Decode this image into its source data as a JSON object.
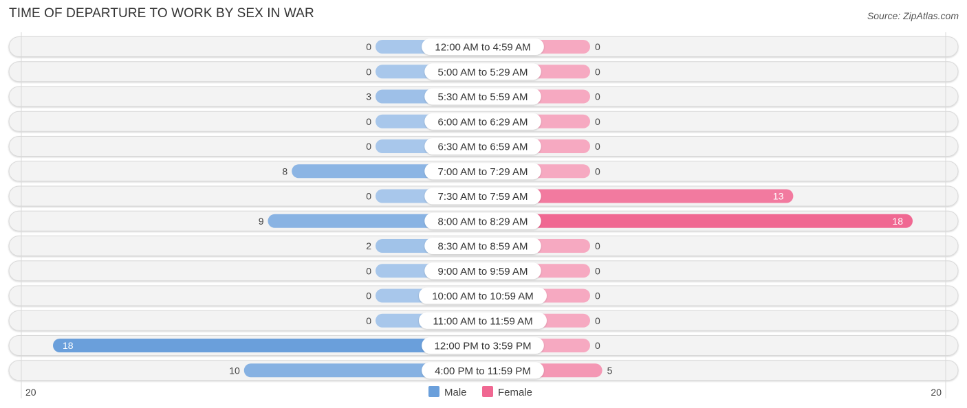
{
  "title": "TIME OF DEPARTURE TO WORK BY SEX IN WAR",
  "source": "Source: ZipAtlas.com",
  "chart_data": {
    "type": "bar",
    "orientation": "horizontal-diverging",
    "title": "TIME OF DEPARTURE TO WORK BY SEX IN WAR",
    "categories": [
      "12:00 AM to 4:59 AM",
      "5:00 AM to 5:29 AM",
      "5:30 AM to 5:59 AM",
      "6:00 AM to 6:29 AM",
      "6:30 AM to 6:59 AM",
      "7:00 AM to 7:29 AM",
      "7:30 AM to 7:59 AM",
      "8:00 AM to 8:29 AM",
      "8:30 AM to 8:59 AM",
      "9:00 AM to 9:59 AM",
      "10:00 AM to 10:59 AM",
      "11:00 AM to 11:59 AM",
      "12:00 PM to 3:59 PM",
      "4:00 PM to 11:59 PM"
    ],
    "series": [
      {
        "name": "Male",
        "color": "#6a9fdb",
        "light_color": "#a8c7eb",
        "values": [
          0,
          0,
          3,
          0,
          0,
          8,
          0,
          9,
          2,
          0,
          0,
          0,
          18,
          10
        ]
      },
      {
        "name": "Female",
        "color": "#f06892",
        "light_color": "#f6a9c1",
        "values": [
          0,
          0,
          0,
          0,
          0,
          0,
          13,
          18,
          0,
          0,
          0,
          0,
          0,
          5
        ]
      }
    ],
    "axis": {
      "left_tick": "20",
      "right_tick": "20",
      "max": 20
    },
    "legend": {
      "position": "bottom-center",
      "items": [
        "Male",
        "Female"
      ]
    },
    "grid": false
  }
}
